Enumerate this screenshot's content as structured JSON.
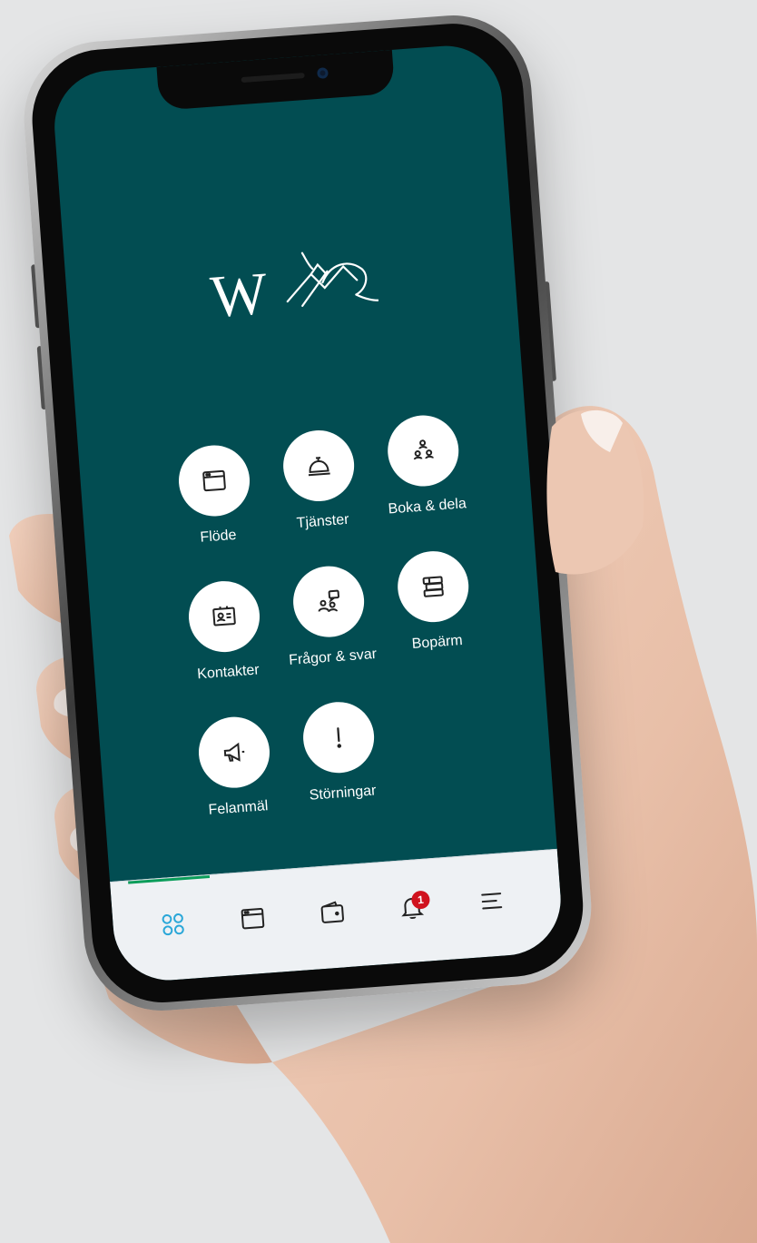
{
  "app": {
    "logo_letter": "W",
    "brand_color": "#024d52",
    "accent_color": "#2aa7d8",
    "badge_color": "#d0121e"
  },
  "menu": {
    "items": [
      {
        "label": "Flöde",
        "icon": "browser-window-icon"
      },
      {
        "label": "Tjänster",
        "icon": "service-bell-icon"
      },
      {
        "label": "Boka & dela",
        "icon": "people-group-icon"
      },
      {
        "label": "Kontakter",
        "icon": "contact-card-icon"
      },
      {
        "label": "Frågor & svar",
        "icon": "question-answer-icon"
      },
      {
        "label": "Bopärm",
        "icon": "binder-stack-icon"
      },
      {
        "label": "Felanmäl",
        "icon": "megaphone-icon"
      },
      {
        "label": "Störningar",
        "icon": "exclamation-icon"
      }
    ]
  },
  "tabbar": {
    "tabs": [
      {
        "name": "home",
        "icon": "grid-circles-icon",
        "active": true
      },
      {
        "name": "feed",
        "icon": "browser-window-icon"
      },
      {
        "name": "wallet",
        "icon": "wallet-icon"
      },
      {
        "name": "notifications",
        "icon": "bell-icon",
        "badge": "1"
      },
      {
        "name": "menu",
        "icon": "menu-lines-icon"
      }
    ]
  }
}
